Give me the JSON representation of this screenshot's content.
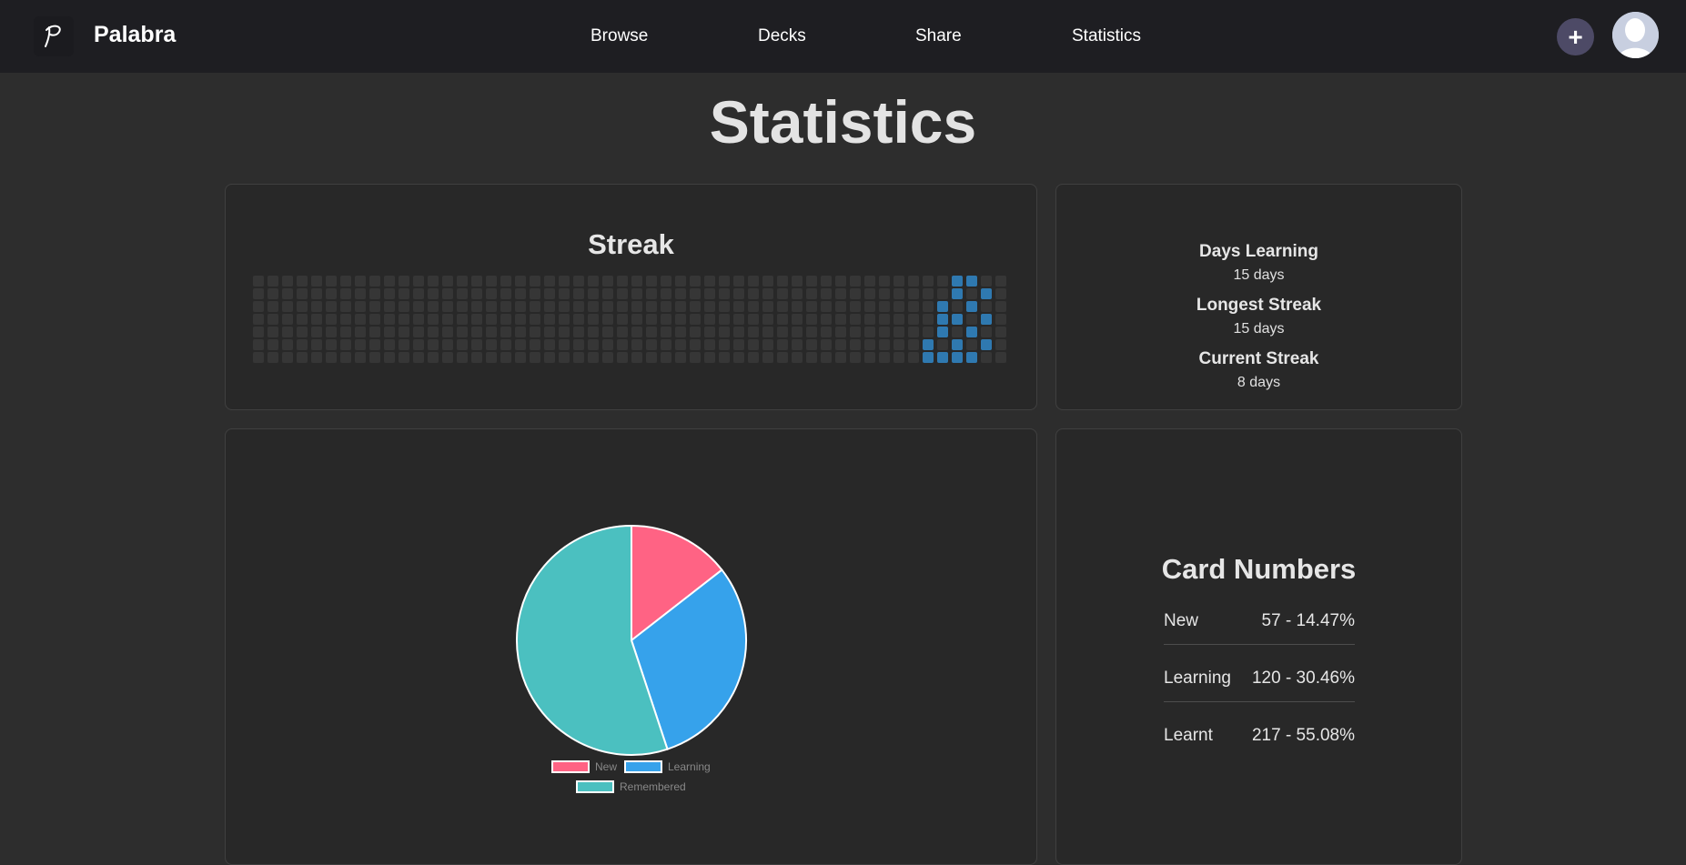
{
  "app": {
    "brand": "Palabra",
    "logo_glyph": "P",
    "nav": [
      {
        "label": "Browse"
      },
      {
        "label": "Decks"
      },
      {
        "label": "Share"
      },
      {
        "label": "Statistics"
      }
    ],
    "add_label": "+"
  },
  "page": {
    "title": "Statistics"
  },
  "streak": {
    "title": "Streak",
    "weeks": 52,
    "days_per_week": 7,
    "active_color": "#2f79b0",
    "inactive_color": "#363636",
    "active_cells": [
      [
        46,
        5
      ],
      [
        46,
        6
      ],
      [
        47,
        2
      ],
      [
        47,
        3
      ],
      [
        47,
        4
      ],
      [
        47,
        6
      ],
      [
        48,
        0
      ],
      [
        48,
        1
      ],
      [
        48,
        3
      ],
      [
        48,
        5
      ],
      [
        48,
        6
      ],
      [
        49,
        0
      ],
      [
        49,
        2
      ],
      [
        49,
        4
      ],
      [
        49,
        6
      ],
      [
        50,
        1
      ],
      [
        50,
        3
      ],
      [
        50,
        5
      ]
    ]
  },
  "summary": {
    "items": [
      {
        "label": "Days Learning",
        "value": "15 days"
      },
      {
        "label": "Longest Streak",
        "value": "15 days"
      },
      {
        "label": "Current Streak",
        "value": "8 days"
      }
    ]
  },
  "chart_data": {
    "type": "pie",
    "categories": [
      "New",
      "Learning",
      "Remembered"
    ],
    "values": [
      57,
      120,
      217
    ],
    "colors": [
      "#ff6384",
      "#36a2eb",
      "#4bc0c0"
    ],
    "legend_position": "bottom"
  },
  "card_numbers": {
    "title": "Card Numbers",
    "rows": [
      {
        "label": "New",
        "value": "57 - 14.47%"
      },
      {
        "label": "Learning",
        "value": "120 - 30.46%"
      },
      {
        "label": "Learnt",
        "value": "217 - 55.08%"
      }
    ]
  }
}
